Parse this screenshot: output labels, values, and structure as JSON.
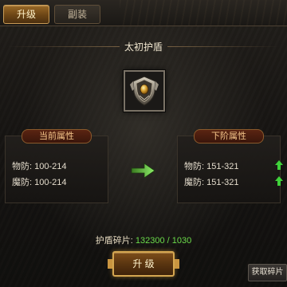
{
  "tabs": [
    {
      "label": "升级",
      "active": true
    },
    {
      "label": "副装",
      "active": false
    }
  ],
  "item": {
    "title": "太初护盾",
    "icon": "shield-icon"
  },
  "current_panel": {
    "header": "当前属性",
    "stats": [
      {
        "label": "物防:",
        "value": "100-214"
      },
      {
        "label": "魔防:",
        "value": "100-214"
      }
    ]
  },
  "next_panel": {
    "header": "下阶属性",
    "stats": [
      {
        "label": "物防:",
        "value": "151-321"
      },
      {
        "label": "魔防:",
        "value": "151-321"
      }
    ]
  },
  "shards": {
    "label": "护盾碎片:",
    "value": "132300 / 1030"
  },
  "buttons": {
    "upgrade": "升 级",
    "get_shards": "获取碎片"
  },
  "colors": {
    "accent_gold": "#d4a650",
    "stat_up_green": "#3fd13a",
    "shard_value_green": "#6bdc4a"
  }
}
